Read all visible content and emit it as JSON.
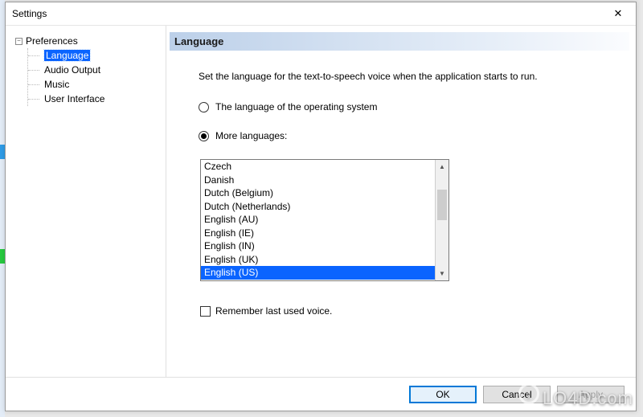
{
  "window": {
    "title": "Settings"
  },
  "sidebar": {
    "root": "Preferences",
    "items": [
      {
        "label": "Language",
        "selected": true
      },
      {
        "label": "Audio Output",
        "selected": false
      },
      {
        "label": "Music",
        "selected": false
      },
      {
        "label": "User Interface",
        "selected": false
      }
    ]
  },
  "panel": {
    "header": "Language",
    "description": "Set the language for the text-to-speech voice when the application starts to run.",
    "radio_os": "The language of the operating system",
    "radio_more": "More languages:",
    "radio_selected": "more",
    "languages": [
      "Czech",
      "Danish",
      "Dutch (Belgium)",
      "Dutch (Netherlands)",
      "English (AU)",
      "English (IE)",
      "English (IN)",
      "English (UK)",
      "English (US)"
    ],
    "selected_language": "English (US)",
    "remember_label": "Remember last used voice.",
    "remember_checked": false
  },
  "buttons": {
    "ok": "OK",
    "cancel": "Cancel",
    "apply": "Apply"
  },
  "watermark": "LO4D.com"
}
